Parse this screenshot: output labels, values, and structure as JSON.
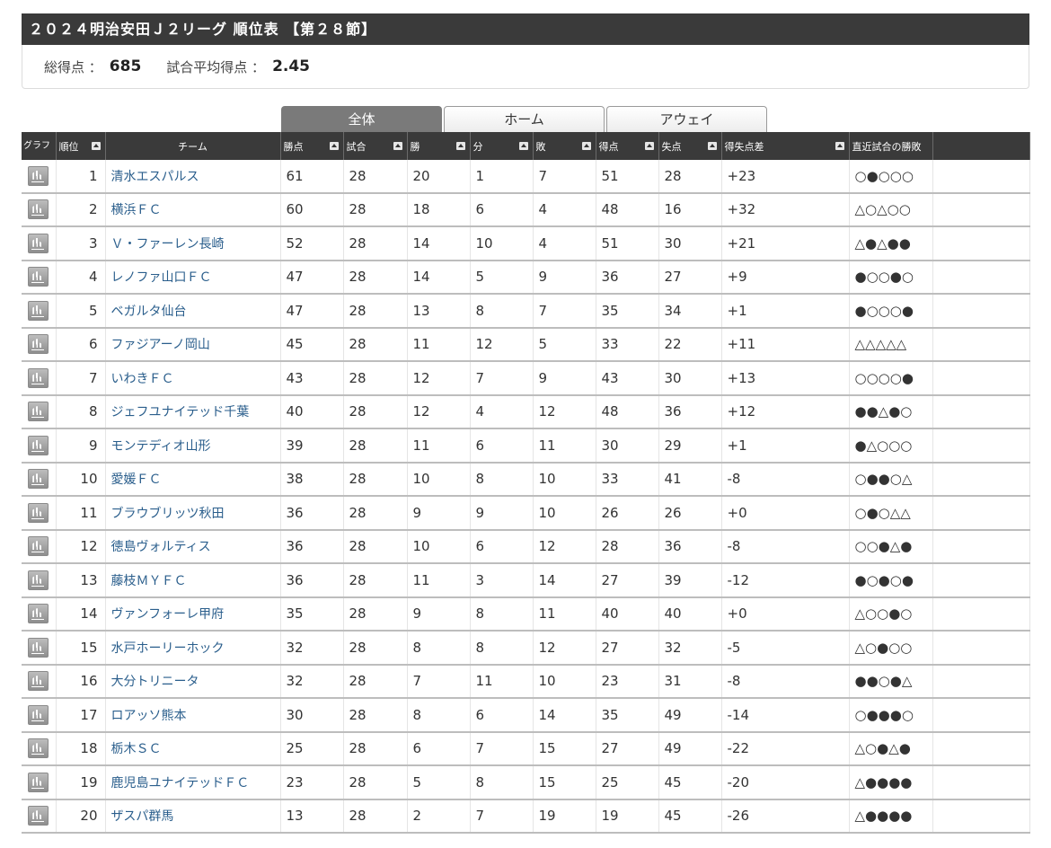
{
  "header": {
    "title": "２０２４明治安田Ｊ２リーグ 順位表 【第２８節】"
  },
  "summary": {
    "total_label": "総得点 ：",
    "total_value": "685",
    "avg_label": "試合平均得点 ：",
    "avg_value": "2.45"
  },
  "tabs": [
    {
      "label": "全体",
      "active": true
    },
    {
      "label": "ホーム",
      "active": false
    },
    {
      "label": "アウェイ",
      "active": false
    }
  ],
  "columns": {
    "graph": "グラフ",
    "rank": "順位",
    "team": "チーム",
    "points": "勝点",
    "played": "試合",
    "won": "勝",
    "draw": "分",
    "lost": "敗",
    "gf": "得点",
    "ga": "失点",
    "gd": "得失点差",
    "recent": "直近試合の勝敗"
  },
  "rows": [
    {
      "rank": "1",
      "team": "清水エスパルス",
      "points": "61",
      "played": "28",
      "won": "20",
      "draw": "1",
      "lost": "7",
      "gf": "51",
      "ga": "28",
      "gd": "+23",
      "recent": "○●○○○"
    },
    {
      "rank": "2",
      "team": "横浜ＦＣ",
      "points": "60",
      "played": "28",
      "won": "18",
      "draw": "6",
      "lost": "4",
      "gf": "48",
      "ga": "16",
      "gd": "+32",
      "recent": "△○△○○"
    },
    {
      "rank": "3",
      "team": "Ｖ・ファーレン長崎",
      "points": "52",
      "played": "28",
      "won": "14",
      "draw": "10",
      "lost": "4",
      "gf": "51",
      "ga": "30",
      "gd": "+21",
      "recent": "△●△●●"
    },
    {
      "rank": "4",
      "team": "レノファ山口ＦＣ",
      "points": "47",
      "played": "28",
      "won": "14",
      "draw": "5",
      "lost": "9",
      "gf": "36",
      "ga": "27",
      "gd": "+9",
      "recent": "●○○●○"
    },
    {
      "rank": "5",
      "team": "ベガルタ仙台",
      "points": "47",
      "played": "28",
      "won": "13",
      "draw": "8",
      "lost": "7",
      "gf": "35",
      "ga": "34",
      "gd": "+1",
      "recent": "●○○○●"
    },
    {
      "rank": "6",
      "team": "ファジアーノ岡山",
      "points": "45",
      "played": "28",
      "won": "11",
      "draw": "12",
      "lost": "5",
      "gf": "33",
      "ga": "22",
      "gd": "+11",
      "recent": "△△△△△"
    },
    {
      "rank": "7",
      "team": "いわきＦＣ",
      "points": "43",
      "played": "28",
      "won": "12",
      "draw": "7",
      "lost": "9",
      "gf": "43",
      "ga": "30",
      "gd": "+13",
      "recent": "○○○○●"
    },
    {
      "rank": "8",
      "team": "ジェフユナイテッド千葉",
      "points": "40",
      "played": "28",
      "won": "12",
      "draw": "4",
      "lost": "12",
      "gf": "48",
      "ga": "36",
      "gd": "+12",
      "recent": "●●△●○"
    },
    {
      "rank": "9",
      "team": "モンテディオ山形",
      "points": "39",
      "played": "28",
      "won": "11",
      "draw": "6",
      "lost": "11",
      "gf": "30",
      "ga": "29",
      "gd": "+1",
      "recent": "●△○○○"
    },
    {
      "rank": "10",
      "team": "愛媛ＦＣ",
      "points": "38",
      "played": "28",
      "won": "10",
      "draw": "8",
      "lost": "10",
      "gf": "33",
      "ga": "41",
      "gd": "-8",
      "recent": "○●●○△"
    },
    {
      "rank": "11",
      "team": "ブラウブリッツ秋田",
      "points": "36",
      "played": "28",
      "won": "9",
      "draw": "9",
      "lost": "10",
      "gf": "26",
      "ga": "26",
      "gd": "+0",
      "recent": "○●○△△"
    },
    {
      "rank": "12",
      "team": "徳島ヴォルティス",
      "points": "36",
      "played": "28",
      "won": "10",
      "draw": "6",
      "lost": "12",
      "gf": "28",
      "ga": "36",
      "gd": "-8",
      "recent": "○○●△●"
    },
    {
      "rank": "13",
      "team": "藤枝ＭＹＦＣ",
      "points": "36",
      "played": "28",
      "won": "11",
      "draw": "3",
      "lost": "14",
      "gf": "27",
      "ga": "39",
      "gd": "-12",
      "recent": "●○●○●"
    },
    {
      "rank": "14",
      "team": "ヴァンフォーレ甲府",
      "points": "35",
      "played": "28",
      "won": "9",
      "draw": "8",
      "lost": "11",
      "gf": "40",
      "ga": "40",
      "gd": "+0",
      "recent": "△○○●○"
    },
    {
      "rank": "15",
      "team": "水戸ホーリーホック",
      "points": "32",
      "played": "28",
      "won": "8",
      "draw": "8",
      "lost": "12",
      "gf": "27",
      "ga": "32",
      "gd": "-5",
      "recent": "△○●○○"
    },
    {
      "rank": "16",
      "team": "大分トリニータ",
      "points": "32",
      "played": "28",
      "won": "7",
      "draw": "11",
      "lost": "10",
      "gf": "23",
      "ga": "31",
      "gd": "-8",
      "recent": "●●○●△"
    },
    {
      "rank": "17",
      "team": "ロアッソ熊本",
      "points": "30",
      "played": "28",
      "won": "8",
      "draw": "6",
      "lost": "14",
      "gf": "35",
      "ga": "49",
      "gd": "-14",
      "recent": "○●●●○"
    },
    {
      "rank": "18",
      "team": "栃木ＳＣ",
      "points": "25",
      "played": "28",
      "won": "6",
      "draw": "7",
      "lost": "15",
      "gf": "27",
      "ga": "49",
      "gd": "-22",
      "recent": "△○●△●"
    },
    {
      "rank": "19",
      "team": "鹿児島ユナイテッドＦＣ",
      "points": "23",
      "played": "28",
      "won": "5",
      "draw": "8",
      "lost": "15",
      "gf": "25",
      "ga": "45",
      "gd": "-20",
      "recent": "△●●●●"
    },
    {
      "rank": "20",
      "team": "ザスパ群馬",
      "points": "13",
      "played": "28",
      "won": "2",
      "draw": "7",
      "lost": "19",
      "gf": "19",
      "ga": "45",
      "gd": "-26",
      "recent": "△●●●●"
    }
  ]
}
